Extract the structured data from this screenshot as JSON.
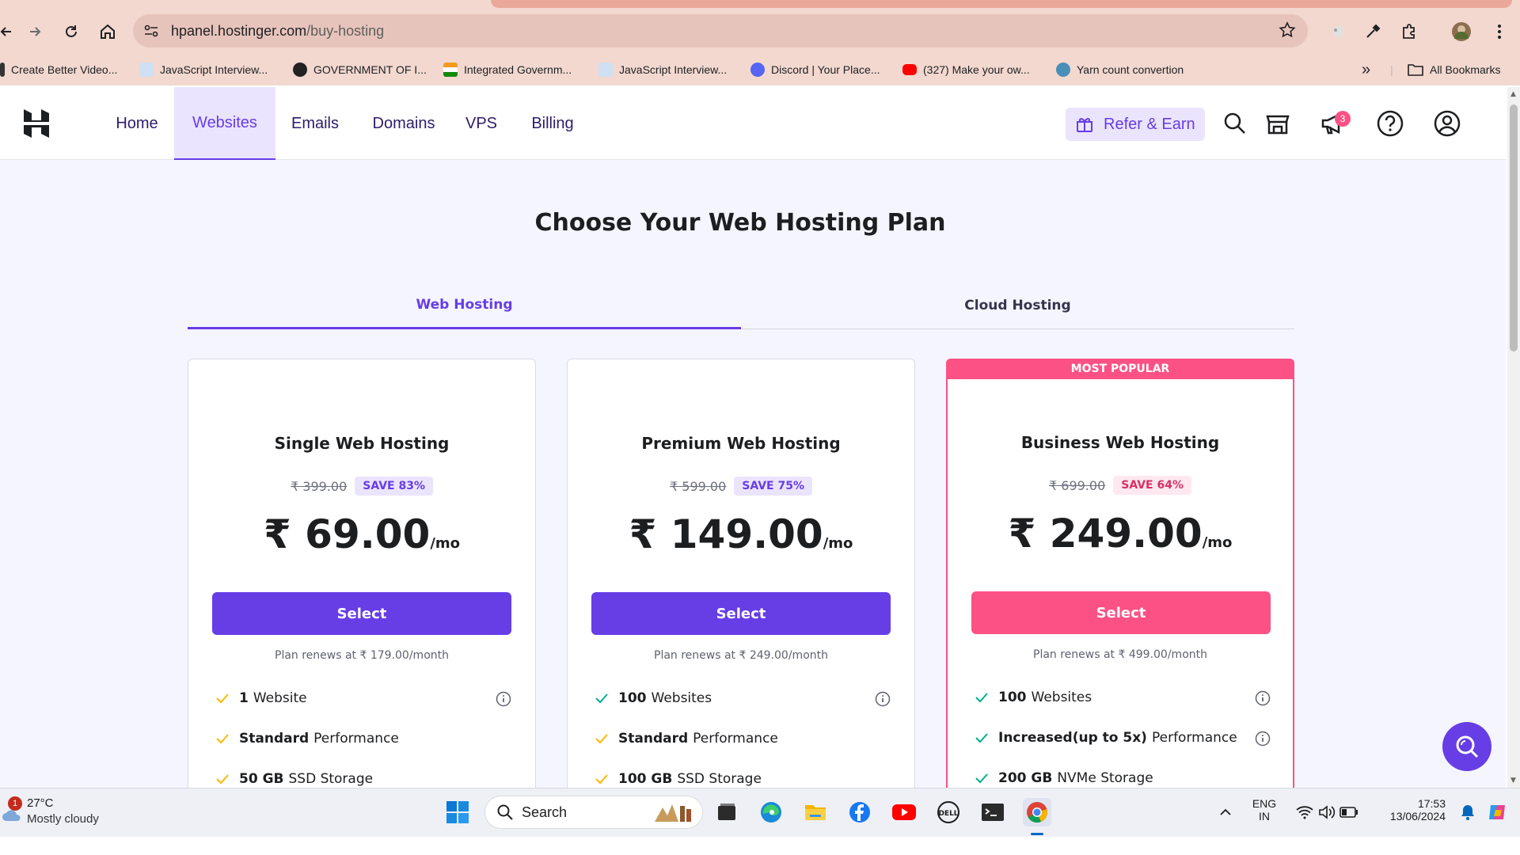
{
  "browser": {
    "url_host": "hpanel.hostinger.com",
    "url_path": "/buy-hosting",
    "bookmarks": [
      {
        "label": "Create Better Video...",
        "color": "#333333"
      },
      {
        "label": "JavaScript Interview...",
        "color": "#7da7d9"
      },
      {
        "label": "GOVERNMENT OF I...",
        "color": "#222222"
      },
      {
        "label": "Integrated Governm...",
        "color": "#f59a23"
      },
      {
        "label": "JavaScript Interview...",
        "color": "#7da7d9"
      },
      {
        "label": "Discord | Your Place...",
        "color": "#5865f2"
      },
      {
        "label": "(327) Make your ow...",
        "color": "#ff0000"
      },
      {
        "label": "Yarn count convertion",
        "color": "#4a8fb8"
      }
    ],
    "all_bookmarks": "All Bookmarks",
    "overflow": "»"
  },
  "header": {
    "nav": [
      "Home",
      "Websites",
      "Emails",
      "Domains",
      "VPS",
      "Billing"
    ],
    "active_nav": "Websites",
    "refer_label": "Refer & Earn",
    "notification_count": "3"
  },
  "page": {
    "title": "Choose Your Web Hosting Plan",
    "tabs": [
      "Web Hosting",
      "Cloud Hosting"
    ],
    "active_tab": "Web Hosting"
  },
  "plans": [
    {
      "name": "Single Web Hosting",
      "old_price": "₹ 399.00",
      "save": "SAVE 83%",
      "price": "₹ 69.00",
      "per": "/mo",
      "select": "Select",
      "renew": "Plan renews at ₹ 179.00/month",
      "features": [
        {
          "bold": "1",
          "text": "Website",
          "info": true
        },
        {
          "bold": "Standard",
          "text": "Performance",
          "info": false
        },
        {
          "bold": "50 GB",
          "text": "SSD Storage",
          "info": false
        }
      ]
    },
    {
      "name": "Premium Web Hosting",
      "old_price": "₹ 599.00",
      "save": "SAVE 75%",
      "price": "₹ 149.00",
      "per": "/mo",
      "select": "Select",
      "renew": "Plan renews at ₹ 249.00/month",
      "features": [
        {
          "bold": "100",
          "text": "Websites",
          "info": true
        },
        {
          "bold": "Standard",
          "text": "Performance",
          "info": false
        },
        {
          "bold": "100 GB",
          "text": "SSD Storage",
          "info": false
        }
      ]
    },
    {
      "name": "Business Web Hosting",
      "banner": "MOST POPULAR",
      "old_price": "₹ 699.00",
      "save": "SAVE 64%",
      "price": "₹ 249.00",
      "per": "/mo",
      "select": "Select",
      "renew": "Plan renews at ₹ 499.00/month",
      "features": [
        {
          "bold": "100",
          "text": "Websites",
          "info": true
        },
        {
          "bold": "Increased(up to 5x)",
          "text": "Performance",
          "info": true
        },
        {
          "bold": "200 GB",
          "text": "NVMe Storage",
          "info": false
        }
      ]
    }
  ],
  "colors": {
    "accent": "#673de6",
    "popular": "#fc5185",
    "check_yellow": "#ffb800",
    "check_teal": "#00b090"
  },
  "taskbar": {
    "weather_badge": "1",
    "temperature": "27°C",
    "condition": "Mostly cloudy",
    "search_placeholder": "Search",
    "lang_top": "ENG",
    "lang_bottom": "IN",
    "time": "17:53",
    "date": "13/06/2024"
  }
}
